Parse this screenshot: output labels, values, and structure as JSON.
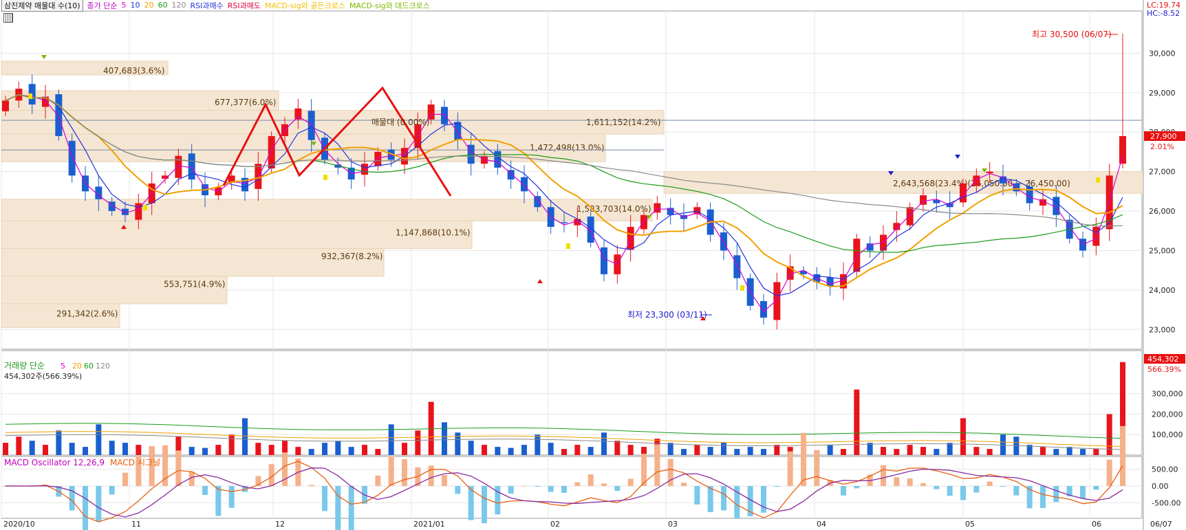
{
  "header": {
    "title": "삼진제약 매물대 수(10)",
    "ma_label": "종가 단순",
    "ma_periods": [
      "5",
      "10",
      "20",
      "60",
      "120"
    ],
    "ma_colors": [
      "#d400d4",
      "#2233dd",
      "#f0a000",
      "#1a9a1a",
      "#888888"
    ],
    "rsi_buy": "RSI과매수",
    "rsi_sell": "RSI과매도",
    "golden": "MACD-sig와 골든크로스",
    "dead": "MACD-sig와 데드크로스",
    "lc": "LC:19.74",
    "hc": "HC:-8.52"
  },
  "price_axis": {
    "ticks": [
      "30,000",
      "29,000",
      "28,000",
      "27,000",
      "26,000",
      "25,000",
      "24,000",
      "23,000"
    ],
    "current_price": "27,900",
    "current_change": "2.01%"
  },
  "annotations": {
    "high": "최고 30,500 (06/07)",
    "low": "최저 23,300 (03/11)",
    "trend_label": "매물대 (0.00%)",
    "range_label": "2,643,568(23.4%)(26,050.00 ~ 26,450.00)"
  },
  "volume_profile": [
    {
      "label": "407,683(3.6%)"
    },
    {
      "label": "677,377(6.0%)"
    },
    {
      "label": "1,611,152(14.2%)"
    },
    {
      "label": "1,472,498(13.0%)"
    },
    {
      "label": "1,583,703(14.0%)"
    },
    {
      "label": "1,147,868(10.1%)"
    },
    {
      "label": "932,367(8.2%)"
    },
    {
      "label": "553,751(4.9%)"
    },
    {
      "label": "291,342(2.6%)"
    }
  ],
  "volume_panel": {
    "title": "거래량 단순",
    "periods": [
      "5",
      "20",
      "60",
      "120"
    ],
    "current": "454,302주(566.39%)",
    "ticks": [
      "300,000",
      "200,000",
      "100,000"
    ],
    "current_value": "454,302",
    "current_pct": "566.39%"
  },
  "macd_panel": {
    "title": "MACD Oscillator 12,26,9",
    "macd": "MACD",
    "signal": "시그널",
    "ticks": [
      "500.00",
      "0.00",
      "-500.00"
    ]
  },
  "date_axis": [
    "2020/10",
    "11",
    "12",
    "2021/01",
    "02",
    "03",
    "04",
    "05",
    "06",
    "06/07"
  ],
  "chart_data": {
    "type": "candlestick",
    "title": "삼진제약",
    "x_range": [
      "2020-10",
      "2021-06-07"
    ],
    "y_range": [
      22500,
      31000
    ],
    "high": 30500,
    "high_date": "06/07",
    "low": 23300,
    "low_date": "03/11",
    "last_close": 27900,
    "close_path": [
      28800,
      29100,
      28700,
      28900,
      27900,
      26900,
      26500,
      26300,
      26000,
      25900,
      26200,
      26700,
      26900,
      27400,
      26800,
      26400,
      26600,
      26900,
      26500,
      27200,
      27900,
      28200,
      28600,
      27800,
      27300,
      27100,
      26800,
      27200,
      27500,
      27300,
      27600,
      28200,
      28700,
      28200,
      27800,
      27200,
      27400,
      27100,
      26800,
      26500,
      26100,
      25600,
      25700,
      25800,
      25200,
      24400,
      24900,
      25600,
      25900,
      26200,
      25900,
      25800,
      26100,
      25400,
      25000,
      24300,
      23600,
      23300,
      24200,
      24600,
      24400,
      24200,
      24100,
      24400,
      25300,
      25000,
      25400,
      25700,
      26100,
      26400,
      26200,
      26100,
      26700,
      26900,
      27000,
      26700,
      26500,
      26200,
      26300,
      25900,
      25300,
      25000,
      25600,
      26900,
      27900
    ]
  }
}
